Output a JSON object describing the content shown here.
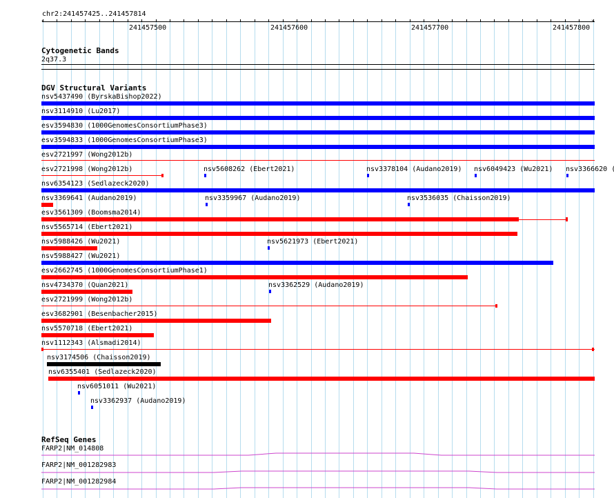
{
  "colors": {
    "gridline": "#b5dcee",
    "deletion": "#ff0000",
    "duplication": "#0000ff",
    "complex": "#000000",
    "gene": "#cc44cc"
  },
  "ruler": {
    "region": "chr2:241457425..241457814",
    "ticks": [
      "241457500",
      "241457600",
      "241457700",
      "241457800"
    ]
  },
  "cytoband": {
    "title": "Cytogenetic Bands",
    "band": "2q37.3"
  },
  "dgv": {
    "title": "DGV Structural Variants",
    "variants": [
      "nsv5437490 (ByrskaBishop2022)",
      "nsv3114910 (Lu2017)",
      "esv3594830 (1000GenomesConsortiumPhase3)",
      "esv3594833 (1000GenomesConsortiumPhase3)",
      "esv2721997 (Wong2012b)",
      "esv2721998 (Wong2012b)",
      "nsv5608262 (Ebert2021)",
      "nsv3378104 (Audano2019)",
      "nsv6049423 (Wu2021)",
      "nsv3366620 (",
      "nsv6354123 (Sedlazeck2020)",
      "nsv3369641 (Audano2019)",
      "nsv3359967 (Audano2019)",
      "nsv3536035 (Chaisson2019)",
      "esv3561309 (Boomsma2014)",
      "nsv5565714 (Ebert2021)",
      "nsv5988426 (Wu2021)",
      "nsv5621973 (Ebert2021)",
      "nsv5988427 (Wu2021)",
      "esv2662745 (1000GenomesConsortiumPhase1)",
      "nsv4734370 (Quan2021)",
      "nsv3362529 (Audano2019)",
      "esv2721999 (Wong2012b)",
      "esv3682901 (Besenbacher2015)",
      "nsv5570718 (Ebert2021)",
      "nsv1112343 (Alsmadi2014)",
      "nsv3174506 (Chaisson2019)",
      "nsv6355401 (Sedlazeck2020)",
      "nsv6051011 (Wu2021)",
      "nsv3362937 (Audano2019)"
    ]
  },
  "refseq": {
    "title": "RefSeq Genes",
    "genes": [
      "FARP2|NM_014808",
      "FARP2|NM_001282983",
      "FARP2|NM_001282984"
    ]
  }
}
